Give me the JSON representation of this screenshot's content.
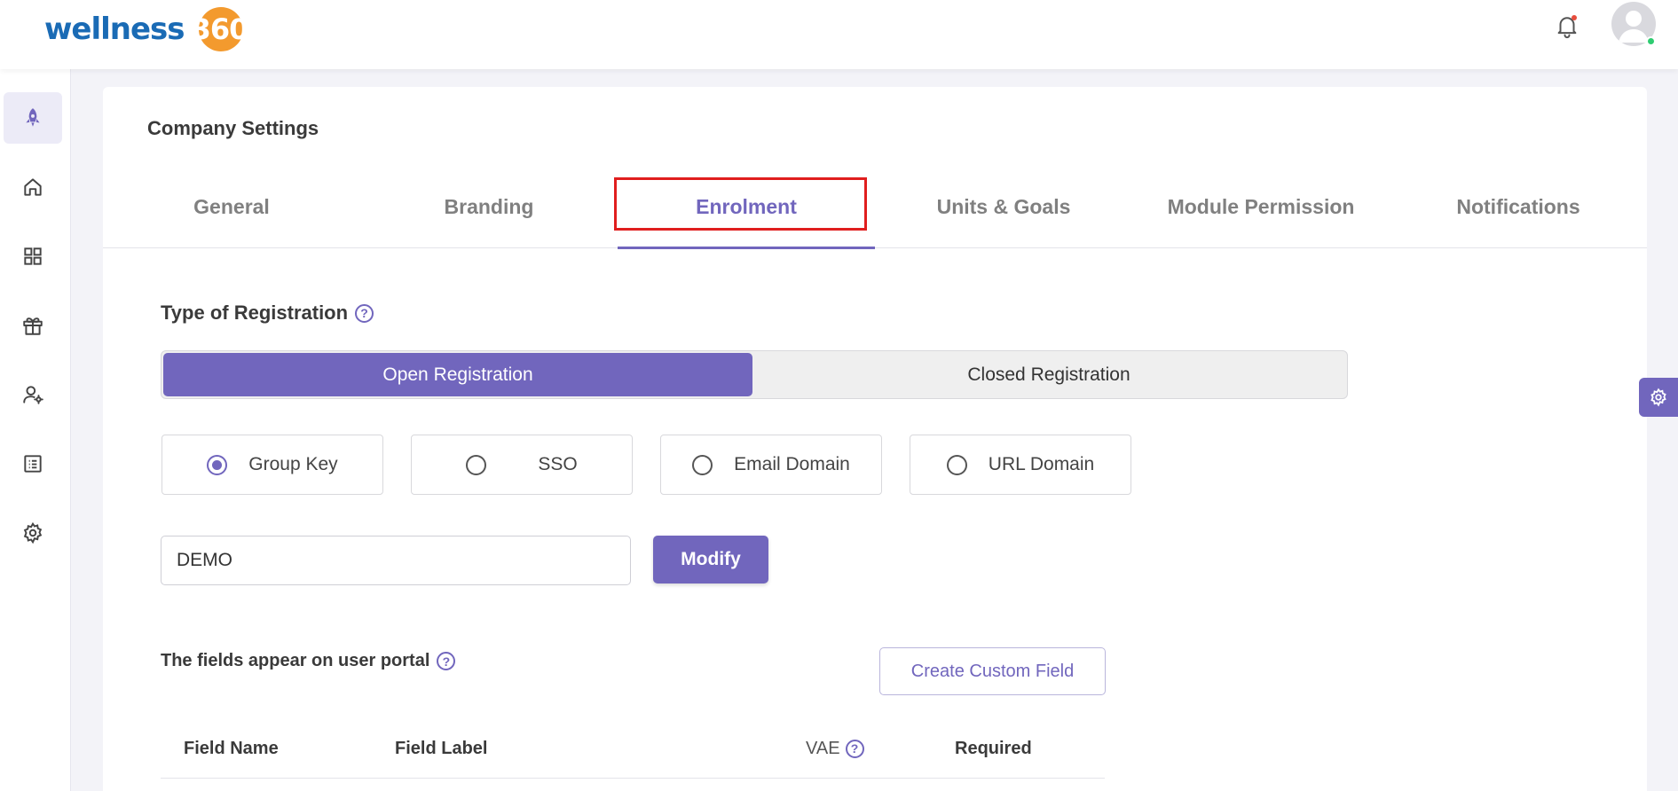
{
  "brand": {
    "name": "wellness",
    "number": "360"
  },
  "header": {
    "bell_icon": "bell-icon",
    "avatar_icon": "user-avatar"
  },
  "sidebar": {
    "items": [
      {
        "icon": "rocket-icon",
        "active": true
      },
      {
        "icon": "home-icon"
      },
      {
        "icon": "grid-icon"
      },
      {
        "icon": "gift-icon"
      },
      {
        "icon": "user-settings-icon"
      },
      {
        "icon": "list-icon"
      },
      {
        "icon": "gear-icon"
      }
    ]
  },
  "page": {
    "title": "Company Settings"
  },
  "tabs": [
    {
      "label": "General"
    },
    {
      "label": "Branding"
    },
    {
      "label": "Enrolment",
      "active": true
    },
    {
      "label": "Units & Goals"
    },
    {
      "label": "Module Permission"
    },
    {
      "label": "Notifications"
    }
  ],
  "registration": {
    "title": "Type of Registration",
    "help": "?",
    "options": [
      "Open Registration",
      "Closed Registration"
    ],
    "selected": "Open Registration",
    "methods": [
      "Group Key",
      "SSO",
      "Email Domain",
      "URL Domain"
    ],
    "selected_method": "Group Key",
    "group_key_value": "DEMO",
    "modify_label": "Modify"
  },
  "fields": {
    "title": "The fields appear on user portal",
    "help": "?",
    "create_label": "Create Custom Field",
    "columns": [
      "Field Name",
      "Field Label",
      "VAE",
      "Required"
    ]
  },
  "colors": {
    "accent": "#7166bd",
    "highlight": "#e01e1e",
    "logo_blue": "#1a6bb5",
    "logo_orange": "#f39a2e"
  }
}
